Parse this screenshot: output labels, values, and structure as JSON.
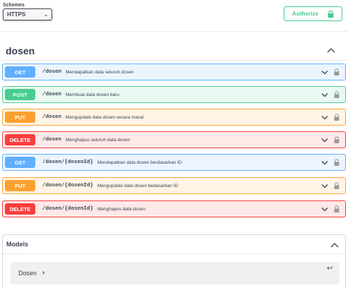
{
  "schemes": {
    "label": "Schemes",
    "selected": "HTTPS"
  },
  "authorize": {
    "label": "Authorize"
  },
  "tag": {
    "title": "dosen"
  },
  "operations": [
    {
      "method": "GET",
      "path": "/dosen",
      "summary": "Mendapatkan data seluruh dosen"
    },
    {
      "method": "POST",
      "path": "/dosen",
      "summary": "Membuat data dosen baru"
    },
    {
      "method": "PUT",
      "path": "/dosen",
      "summary": "Mengupdate data dosen secara masal"
    },
    {
      "method": "DELETE",
      "path": "/dosen",
      "summary": "Menghapus seluruh data dosen"
    },
    {
      "method": "GET",
      "path": "/dosen/{dosenId}",
      "summary": "Mendapatkan data dosen berdasarkan ID"
    },
    {
      "method": "PUT",
      "path": "/dosen/{dosenId}",
      "summary": "Mengupdate data dosen bedasarkan ID"
    },
    {
      "method": "DELETE",
      "path": "/dosen/{dosenId}",
      "summary": "Menghapus data dosen"
    }
  ],
  "models": {
    "title": "Models",
    "items": [
      {
        "name": "Dosen"
      }
    ]
  },
  "colors": {
    "get": "#61affe",
    "post": "#49cc90",
    "put": "#fca130",
    "delete": "#f93e3e"
  }
}
